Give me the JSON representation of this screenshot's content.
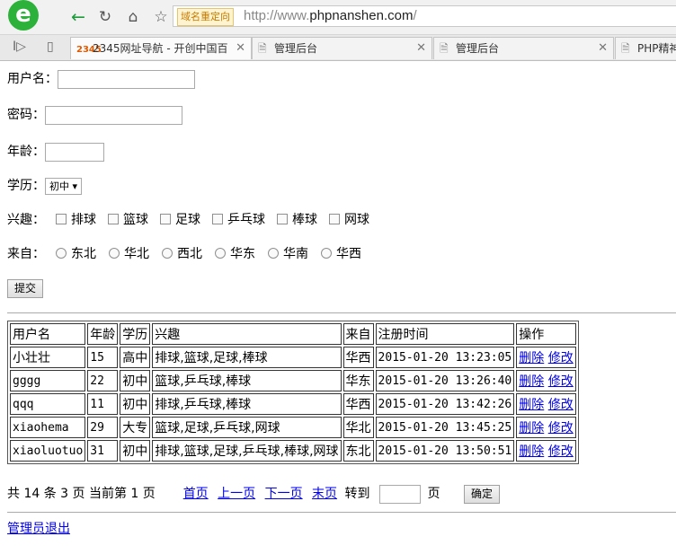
{
  "browser": {
    "url_prefix": "http://www.",
    "url_domain": "phpnanshen.com",
    "url_suffix": "/",
    "redirect_badge": "域名重定向",
    "tabs": [
      {
        "title": "2345网址导航 - 开创中国百",
        "favicon": "2345"
      },
      {
        "title": "管理后台",
        "favicon": "page"
      },
      {
        "title": "管理后台",
        "favicon": "page"
      },
      {
        "title": "PHP精神",
        "favicon": "page"
      }
    ]
  },
  "form": {
    "username_label": "用户名：",
    "password_label": "密码：",
    "age_label": "年龄：",
    "education_label": "学历：",
    "education_value": "初中",
    "hobbies_label": "兴趣：",
    "hobbies": [
      "排球",
      "篮球",
      "足球",
      "乒乓球",
      "棒球",
      "网球"
    ],
    "from_label": "来自：",
    "regions": [
      "东北",
      "华北",
      "西北",
      "华东",
      "华南",
      "华西"
    ],
    "submit_label": "提交"
  },
  "table": {
    "headers": [
      "用户名",
      "年龄",
      "学历",
      "兴趣",
      "来自",
      "注册时间",
      "操作"
    ],
    "rows": [
      {
        "username": "小壮壮",
        "age": "15",
        "education": "高中",
        "hobbies": "排球,篮球,足球,棒球",
        "from": "华西",
        "registered": "2015-01-20 13:23:05"
      },
      {
        "username": "gggg",
        "age": "22",
        "education": "初中",
        "hobbies": "篮球,乒乓球,棒球",
        "from": "华东",
        "registered": "2015-01-20 13:26:40"
      },
      {
        "username": "qqq",
        "age": "11",
        "education": "初中",
        "hobbies": "排球,乒乓球,棒球",
        "from": "华西",
        "registered": "2015-01-20 13:42:26"
      },
      {
        "username": "xiaohema",
        "age": "29",
        "education": "大专",
        "hobbies": "篮球,足球,乒乓球,网球",
        "from": "华北",
        "registered": "2015-01-20 13:45:25"
      },
      {
        "username": "xiaoluotuo",
        "age": "31",
        "education": "初中",
        "hobbies": "排球,篮球,足球,乒乓球,棒球,网球",
        "from": "东北",
        "registered": "2015-01-20 13:50:51"
      }
    ],
    "delete_label": "删除",
    "edit_label": "修改"
  },
  "pager": {
    "summary": "共 14 条 3 页 当前第 1 页",
    "first": "首页",
    "prev": "上一页",
    "next": "下一页",
    "last": "末页",
    "goto_label": "转到",
    "page_unit": "页",
    "confirm_label": "确定"
  },
  "logout_label": "管理员退出"
}
